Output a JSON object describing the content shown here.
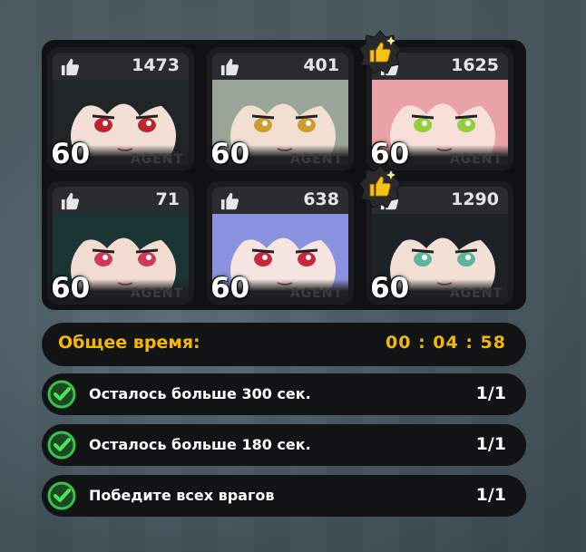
{
  "colors": {
    "accent_gold": "#f5b800",
    "panel_bg": "#121315",
    "check_green": "#3cc24a"
  },
  "characters": [
    {
      "likes": "1473",
      "level": "60",
      "tag": "AGENT",
      "featured": false,
      "hair": "#202527",
      "eye": "#c0272d",
      "skin": "#f3dfd6"
    },
    {
      "likes": "401",
      "level": "60",
      "tag": "AGENT",
      "featured": false,
      "hair": "#9aa497",
      "eye": "#d19a2e",
      "skin": "#f1dfd2"
    },
    {
      "likes": "1625",
      "level": "60",
      "tag": "AGENT",
      "featured": true,
      "hair": "#e9a2a6",
      "eye": "#8fcf3a",
      "skin": "#f6e0d8"
    },
    {
      "likes": "71",
      "level": "60",
      "tag": "AGENT",
      "featured": false,
      "hair": "#1b3434",
      "eye": "#d03a5a",
      "skin": "#f2dcd2"
    },
    {
      "likes": "638",
      "level": "60",
      "tag": "AGENT",
      "featured": false,
      "hair": "#8a92e0",
      "eye": "#c8283e",
      "skin": "#f6e4e0"
    },
    {
      "likes": "1290",
      "level": "60",
      "tag": "AGENT",
      "featured": true,
      "hair": "#1d2226",
      "eye": "#5fb59a",
      "skin": "#f2dfd6"
    }
  ],
  "icons": {
    "like": "thumbs-up-icon",
    "featured_badge": "gold-thumbs-up-badge-icon",
    "check": "check-circle-icon"
  },
  "timer": {
    "label": "Общее время:",
    "value": "00 : 04 : 58"
  },
  "objectives": [
    {
      "text": "Осталось больше 300 сек.",
      "progress": "1/1",
      "completed": true
    },
    {
      "text": "Осталось больше 180 сек.",
      "progress": "1/1",
      "completed": true
    },
    {
      "text": "Победите всех врагов",
      "progress": "1/1",
      "completed": true
    }
  ]
}
